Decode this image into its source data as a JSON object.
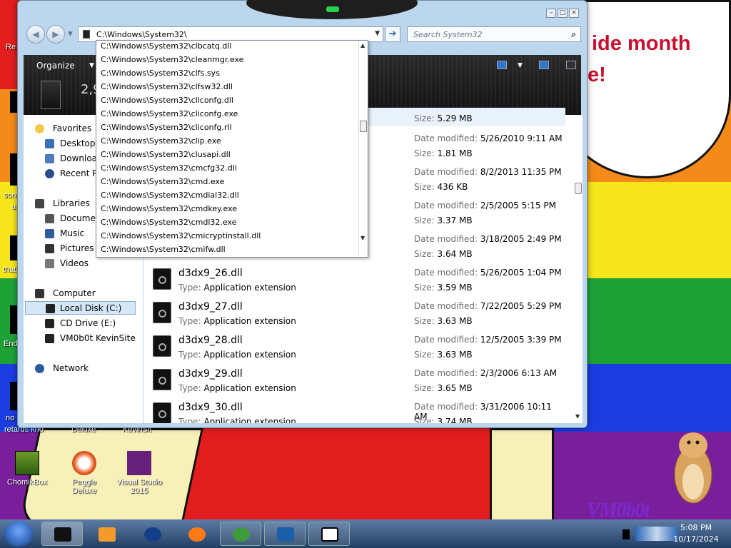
{
  "desktop": {
    "bubble_line1": "ide month",
    "bubble_line2": "e!",
    "left_fragments": [
      "Re",
      "son",
      "u",
      "that",
      "End",
      "no",
      "retards kno"
    ],
    "icons": [
      {
        "label": "ChomikBox"
      },
      {
        "label": "Peggle Deluxe"
      },
      {
        "label": "Visual Studio 2015"
      }
    ],
    "partial_icons": [
      "Deluxe",
      "KevinSit"
    ],
    "watermark": "VM0b0t"
  },
  "window": {
    "address": "C:\\Windows\\System32\\",
    "search_placeholder": "Search System32",
    "toolbar": {
      "organize": "Organize",
      "count_partial": "2,9"
    },
    "nav": {
      "favorites": "Favorites",
      "desktop": "Desktop",
      "downloads": "Downloa",
      "recent": "Recent Pla",
      "libraries": "Libraries",
      "documents": "Documen",
      "music": "Music",
      "pictures": "Pictures",
      "videos": "Videos",
      "computer": "Computer",
      "local_disk": "Local Disk (C:)",
      "cd_drive": "CD Drive (E:)",
      "kevinsite": "VM0b0t KevinSite",
      "network": "Network"
    },
    "labels": {
      "date_modified": "Date modified:",
      "size": "Size:",
      "type": "Type:"
    },
    "partial_rows": [
      {
        "size": "5.29 MB"
      },
      {
        "date": "5/26/2010 9:11 AM",
        "size": "1.81 MB"
      },
      {
        "date": "8/2/2013 11:35 PM",
        "size": "436 KB"
      },
      {
        "date": "2/5/2005 5:15 PM",
        "size": "3.37 MB"
      },
      {
        "date": "3/18/2005 2:49 PM",
        "size": "3.64 MB"
      }
    ],
    "files": [
      {
        "name": "d3dx9_26.dll",
        "type": "Application extension",
        "date": "5/26/2005 1:04 PM",
        "size": "3.59 MB"
      },
      {
        "name": "d3dx9_27.dll",
        "type": "Application extension",
        "date": "7/22/2005 5:29 PM",
        "size": "3.63 MB"
      },
      {
        "name": "d3dx9_28.dll",
        "type": "Application extension",
        "date": "12/5/2005 3:39 PM",
        "size": "3.63 MB"
      },
      {
        "name": "d3dx9_29.dll",
        "type": "Application extension",
        "date": "2/3/2006 6:13 AM",
        "size": "3.65 MB"
      },
      {
        "name": "d3dx9_30.dll",
        "type": "Application extension",
        "date": "3/31/2006 10:11 AM",
        "size": "3.74 MB"
      }
    ]
  },
  "autocomplete": [
    "C:\\Windows\\System32\\clbcatq.dll",
    "C:\\Windows\\System32\\cleanmgr.exe",
    "C:\\Windows\\System32\\clfs.sys",
    "C:\\Windows\\System32\\clfsw32.dll",
    "C:\\Windows\\System32\\cliconfg.dll",
    "C:\\Windows\\System32\\cliconfg.exe",
    "C:\\Windows\\System32\\cliconfg.rll",
    "C:\\Windows\\System32\\clip.exe",
    "C:\\Windows\\System32\\clusapi.dll",
    "C:\\Windows\\System32\\cmcfg32.dll",
    "C:\\Windows\\System32\\cmd.exe",
    "C:\\Windows\\System32\\cmdial32.dll",
    "C:\\Windows\\System32\\cmdkey.exe",
    "C:\\Windows\\System32\\cmdl32.exe",
    "C:\\Windows\\System32\\cmicryptinstall.dll",
    "C:\\Windows\\System32\\cmifw.dll"
  ],
  "taskbar": {
    "time": "5:08 PM",
    "date": "10/17/2024"
  },
  "colors": {
    "rainbow": [
      "#e21d1d",
      "#f38a1a",
      "#f5e51a",
      "#1ea238",
      "#1b3de0",
      "#7a1f9c"
    ],
    "accent": "#2c64b5"
  }
}
